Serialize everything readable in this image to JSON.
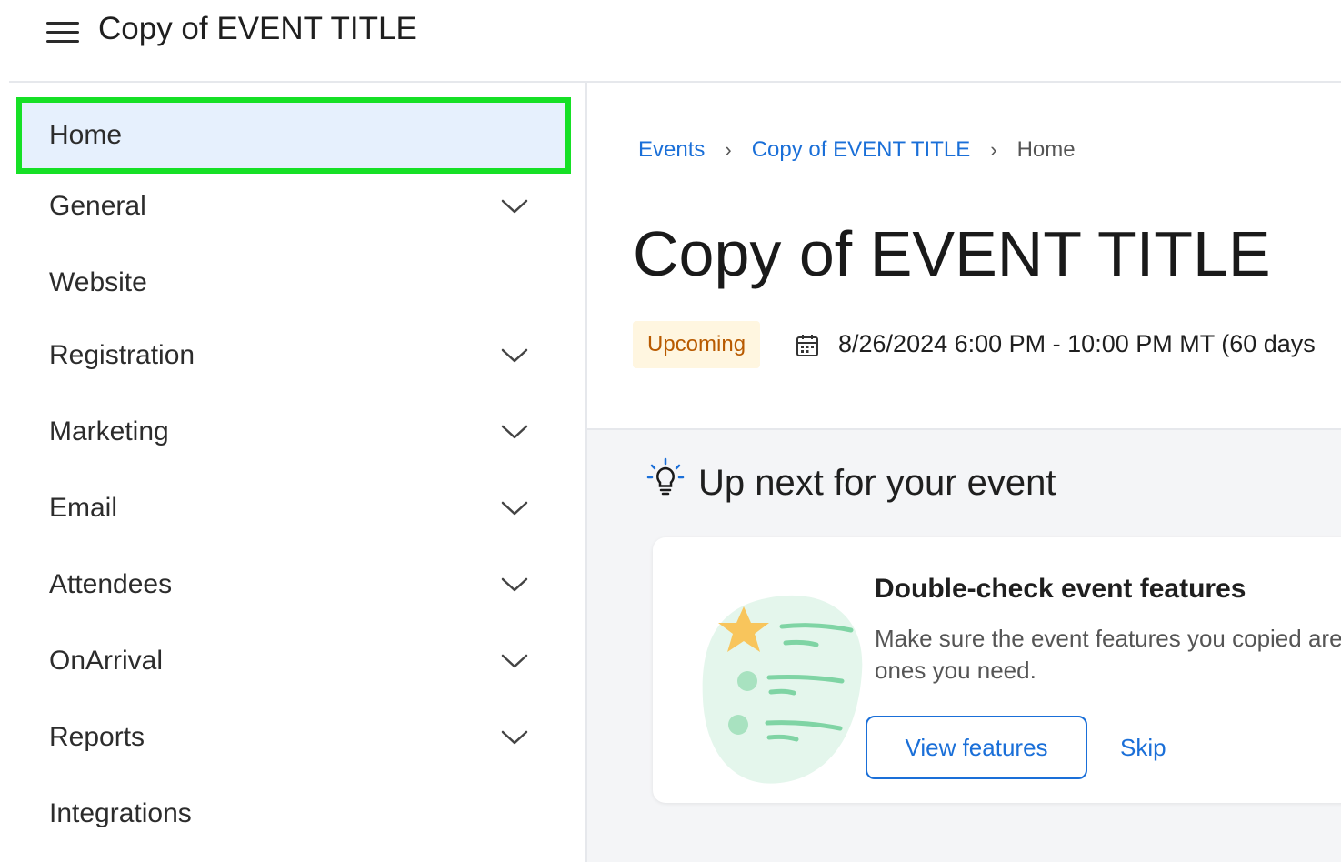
{
  "app": {
    "title": "Copy of EVENT TITLE"
  },
  "sidebar": {
    "items": [
      {
        "label": "Home"
      },
      {
        "label": "General"
      },
      {
        "label": "Website"
      },
      {
        "label": "Registration"
      },
      {
        "label": "Marketing"
      },
      {
        "label": "Email"
      },
      {
        "label": "Attendees"
      },
      {
        "label": "OnArrival"
      },
      {
        "label": "Reports"
      },
      {
        "label": "Integrations"
      }
    ]
  },
  "breadcrumb": {
    "items": [
      "Events",
      "Copy of EVENT TITLE"
    ],
    "current": "Home"
  },
  "event": {
    "title": "Copy of EVENT TITLE",
    "status": "Upcoming",
    "date": "8/26/2024 6:00 PM - 10:00 PM MT (60 days"
  },
  "up_next": {
    "heading": "Up next for your event",
    "card": {
      "title": "Double-check event features",
      "description": "Make sure the event features you copied are the ones you need.",
      "primary_button": "View features",
      "secondary_button": "Skip"
    }
  },
  "colors": {
    "accent": "#1a6fd8",
    "active_bg": "#e6f0fd",
    "highlight_border": "#16e026",
    "status_bg": "#fff6e0",
    "status_text": "#b85a00"
  },
  "icons": {
    "menu": "hamburger-menu-icon",
    "expand": "chevron-down-icon",
    "separator": "chevron-right-icon",
    "date": "calendar-icon",
    "tip": "lightbulb-icon",
    "card_art": "checklist-illustration"
  }
}
